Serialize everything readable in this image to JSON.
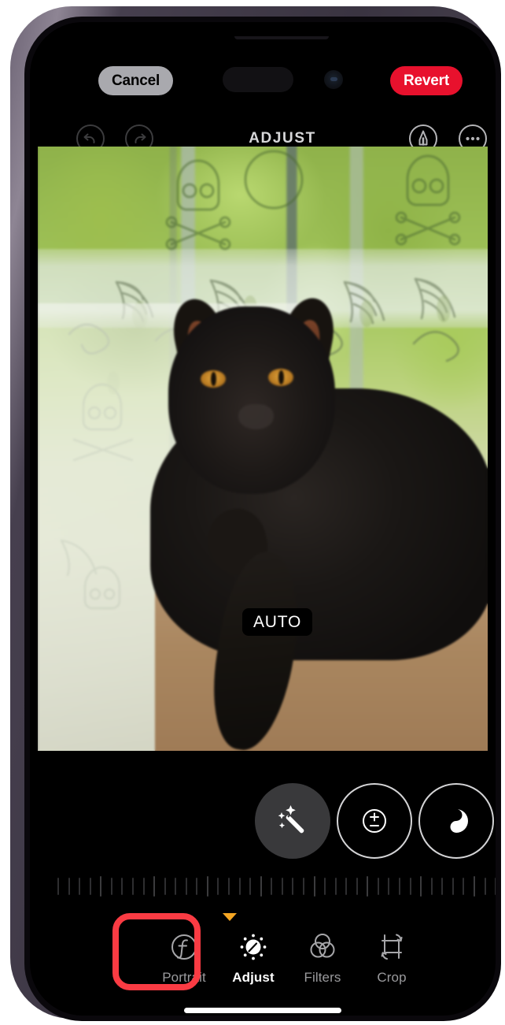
{
  "device": {
    "frame": "iphone-14-pro",
    "dynamic_island": "dynamic-island",
    "home_indicator": "home-indicator"
  },
  "top_actions": {
    "cancel_label": "Cancel",
    "revert_label": "Revert",
    "cancel_bg": "#a9a9ae",
    "revert_bg": "#e8112d"
  },
  "editor_header": {
    "title": "ADJUST",
    "undo_icon": "undo-arrow-icon",
    "redo_icon": "redo-arrow-icon",
    "markup_icon": "markup-pen-icon",
    "more_icon": "ellipsis-icon"
  },
  "photo": {
    "badge_label": "AUTO",
    "subject": "black cat on tan perch in front of halloween skull curtain",
    "accent_pink": "#c51c5e",
    "accent_tan": "#b2906b",
    "accent_green": "#a4c75c"
  },
  "adjust_tools": [
    {
      "name": "auto-enhance",
      "icon": "magic-wand-icon",
      "selected": true
    },
    {
      "name": "exposure",
      "icon": "exposure-plus-minus-icon",
      "selected": false
    },
    {
      "name": "brilliance",
      "icon": "brilliance-half-circle-icon",
      "selected": false
    }
  ],
  "slider": {
    "tick_count": 43,
    "tick_color": "#2e2e30"
  },
  "mode_bar": {
    "items": [
      {
        "label": "Portrait",
        "icon": "portrait-f-stop-icon",
        "active": false,
        "highlighted": true
      },
      {
        "label": "Adjust",
        "icon": "adjust-dial-icon",
        "active": true,
        "highlighted": false
      },
      {
        "label": "Filters",
        "icon": "filters-circles-icon",
        "active": false,
        "highlighted": false
      },
      {
        "label": "Crop",
        "icon": "crop-rotate-icon",
        "active": false,
        "highlighted": false
      }
    ],
    "active_indicator_color": "#f5a623",
    "highlight_color": "#fa3b43"
  }
}
